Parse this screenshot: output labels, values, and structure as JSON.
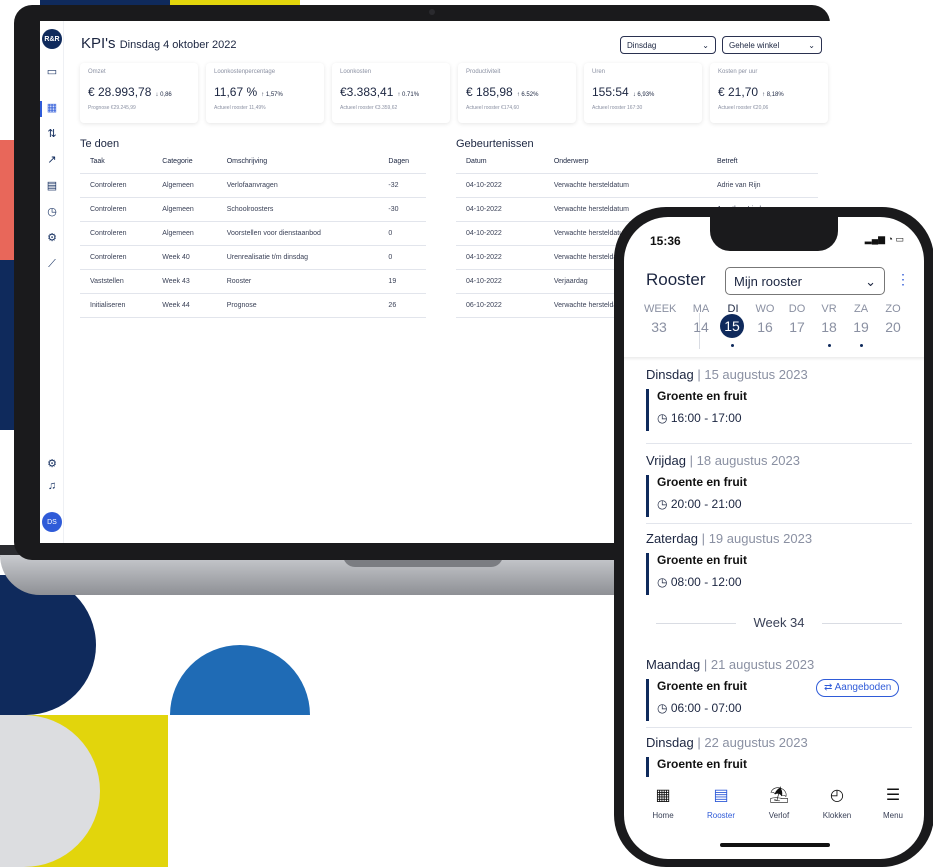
{
  "desktop": {
    "logo": "R&R",
    "title": "KPI's",
    "date": "Dinsdag 4 oktober 2022",
    "day_select": "Dinsdag",
    "scope_select": "Gehele winkel",
    "avatar": "DS",
    "kpis": [
      {
        "label": "Omzet",
        "value": "€ 28.993,78",
        "delta": "↓ 0,86",
        "sub": "Prognose €29.245,99"
      },
      {
        "label": "Loonkostenpercentage",
        "value": "11,67 %",
        "delta": "↑ 1,57%",
        "sub": "Actueel rooster 11,49%"
      },
      {
        "label": "Loonkosten",
        "value": "€3.383,41",
        "delta": "↑ 0.71%",
        "sub": "Actueel rooster €3.359,62"
      },
      {
        "label": "Productiviteit",
        "value": "€ 185,98",
        "delta": "↑ 6.52%",
        "sub": "Actueel rooster €174,60"
      },
      {
        "label": "Uren",
        "value": "155:54",
        "delta": "↓ 6,93%",
        "sub": "Actueel rooster 167:30"
      },
      {
        "label": "Kosten per uur",
        "value": "€ 21,70",
        "delta": "↑ 8,18%",
        "sub": "Actueel rooster €20,06"
      }
    ],
    "todo": {
      "title": "Te doen",
      "headers": [
        "Taak",
        "Categorie",
        "Omschrijving",
        "Dagen"
      ],
      "rows": [
        [
          "Controleren",
          "Algemeen",
          "Verlofaanvragen",
          "-32"
        ],
        [
          "Controleren",
          "Algemeen",
          "Schoolroosters",
          "-30"
        ],
        [
          "Controleren",
          "Algemeen",
          "Voorstellen voor dienstaanbod",
          "0"
        ],
        [
          "Controleren",
          "Week 40",
          "Urenrealisatie t/m dinsdag",
          "0"
        ],
        [
          "Vaststellen",
          "Week 43",
          "Rooster",
          "19"
        ],
        [
          "Initialiseren",
          "Week 44",
          "Prognose",
          "26"
        ]
      ]
    },
    "events": {
      "title": "Gebeurtenissen",
      "headers": [
        "Datum",
        "Onderwerp",
        "Betreft"
      ],
      "rows": [
        [
          "04-10-2022",
          "Verwachte hersteldatum",
          "Adrie van Rijn"
        ],
        [
          "04-10-2022",
          "Verwachte hersteldatum",
          "Jonathan Linde"
        ],
        [
          "04-10-2022",
          "Verwachte hersteldatum",
          ""
        ],
        [
          "04-10-2022",
          "Verwachte hersteldatum",
          ""
        ],
        [
          "04-10-2022",
          "Verjaardag",
          ""
        ],
        [
          "06-10-2022",
          "Verwachte hersteldatum",
          ""
        ]
      ]
    }
  },
  "phone": {
    "time": "15:36",
    "title": "Rooster",
    "select": "Mijn rooster",
    "week_label": "WEEK",
    "week_number": "33",
    "days": [
      {
        "abbr": "MA",
        "num": "14"
      },
      {
        "abbr": "DI",
        "num": "15"
      },
      {
        "abbr": "WO",
        "num": "16"
      },
      {
        "abbr": "DO",
        "num": "17"
      },
      {
        "abbr": "VR",
        "num": "18"
      },
      {
        "abbr": "ZA",
        "num": "19"
      },
      {
        "abbr": "ZO",
        "num": "20"
      }
    ],
    "entries": [
      {
        "day": "Dinsdag",
        "date": "15 augustus 2023",
        "name": "Groente en fruit",
        "time": "16:00 - 17:00"
      },
      {
        "day": "Vrijdag",
        "date": "18 augustus 2023",
        "name": "Groente en fruit",
        "time": "20:00 - 21:00"
      },
      {
        "day": "Zaterdag",
        "date": "19 augustus 2023",
        "name": "Groente en fruit",
        "time": "08:00 - 12:00"
      },
      {
        "day": "Maandag",
        "date": "21 augustus 2023",
        "name": "Groente en fruit",
        "time": "06:00 - 07:00",
        "badge": "Aangeboden"
      },
      {
        "day": "Dinsdag",
        "date": "22 augustus 2023",
        "name": "Groente en fruit"
      }
    ],
    "week_separator": "Week 34",
    "tabs": [
      {
        "label": "Home",
        "icon": "home-icon"
      },
      {
        "label": "Rooster",
        "icon": "calendar-icon"
      },
      {
        "label": "Verlof",
        "icon": "beach-icon"
      },
      {
        "label": "Klokken",
        "icon": "stopwatch-icon"
      },
      {
        "label": "Menu",
        "icon": "menu-icon"
      }
    ]
  },
  "colors": {
    "navy": "#0f2a5c",
    "accent": "#2f5bd8",
    "yellow": "#e2d50c",
    "blue": "#1f6bb5",
    "coral": "#e8675a"
  }
}
